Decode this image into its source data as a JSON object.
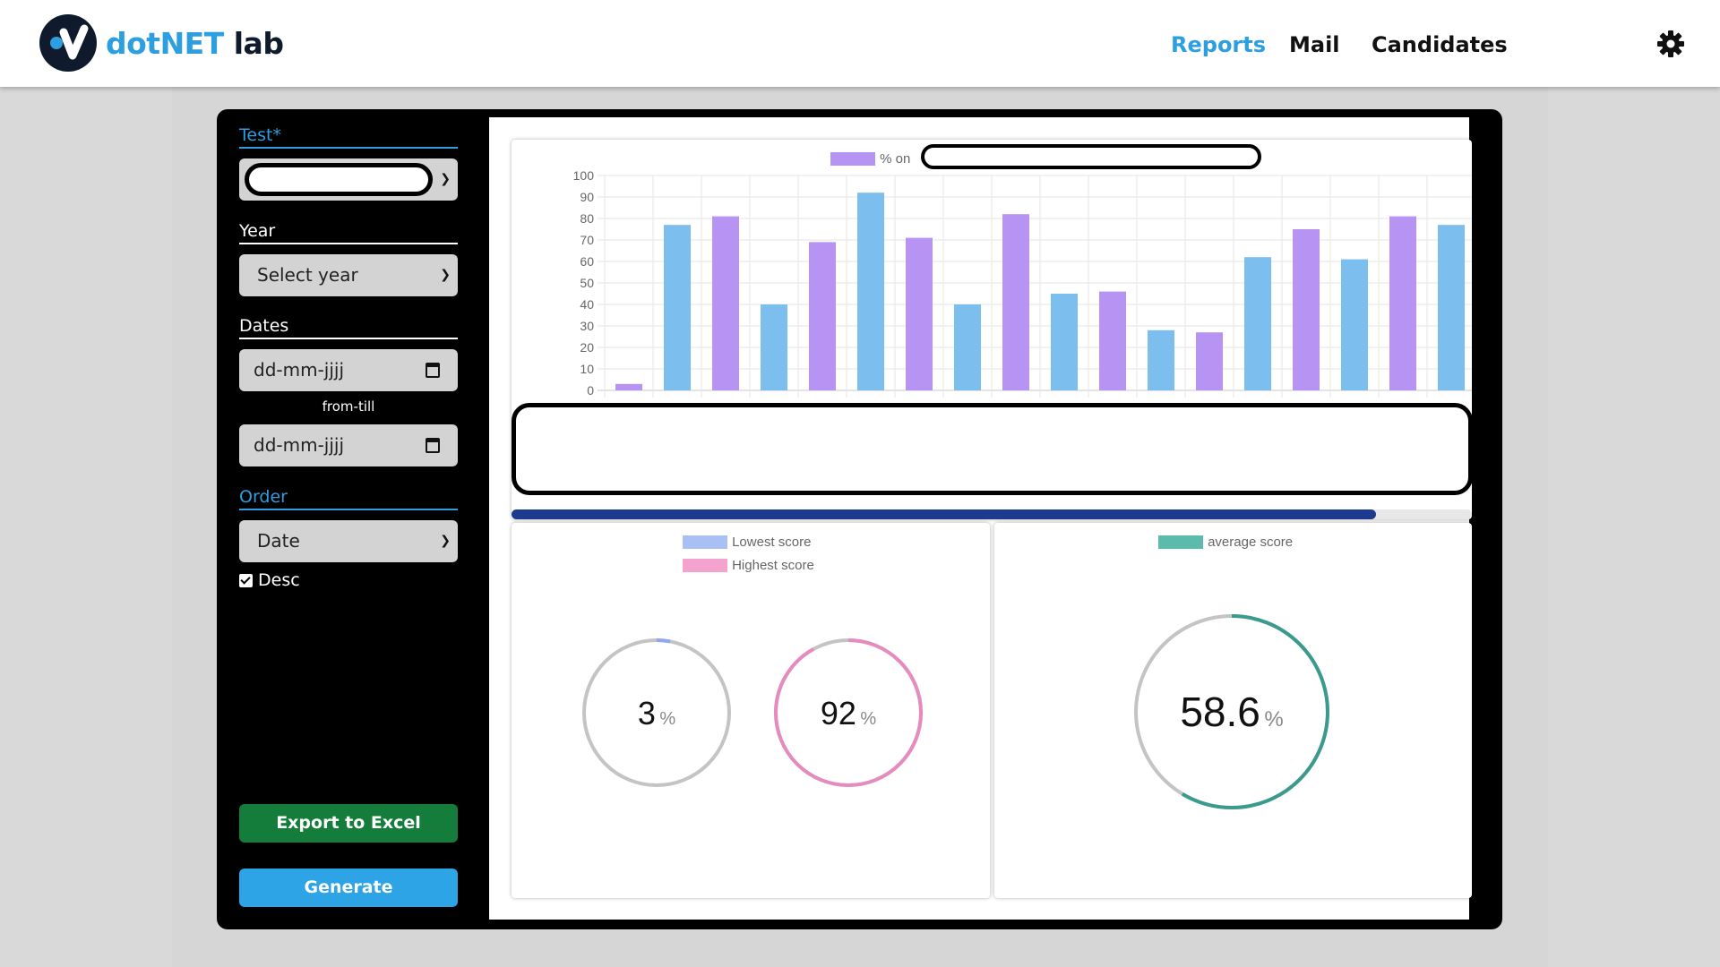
{
  "nav": {
    "logo_part1": "dotNET",
    "logo_part2": " lab",
    "links": [
      "Reports",
      "Mail",
      "Candidates"
    ],
    "active": "Reports"
  },
  "sidebar": {
    "test_label": "Test*",
    "year_label": "Year",
    "year_value": "Select year",
    "dates_label": "Dates",
    "date_placeholder": "dd-mm-jjjj",
    "from_till": "from-till",
    "order_label": "Order",
    "order_value": "Date",
    "desc_label": "Desc",
    "desc_checked": true,
    "export_label": "Export to Excel",
    "generate_label": "Generate"
  },
  "colors": {
    "accent": "#2d9ee0",
    "bar_purple": "#b794f4",
    "bar_blue": "#7cbeee",
    "lowest": "#a9c0f5",
    "highest": "#f4a3cf",
    "average": "#5bbcae",
    "scroll_thumb": "#1e3a8f",
    "export_button": "#157d3b",
    "generate_button": "#2da4e6"
  },
  "chart_data": [
    {
      "type": "bar",
      "legend_prefix": "% on",
      "ylim": [
        0,
        100
      ],
      "yticks": [
        0,
        10,
        20,
        30,
        40,
        50,
        60,
        70,
        80,
        90,
        100
      ],
      "grid": true,
      "values": [
        3,
        77,
        81,
        40,
        69,
        92,
        71,
        40,
        82,
        45,
        46,
        28,
        27,
        62,
        75,
        61,
        81,
        77
      ],
      "bar_colors": [
        "purple",
        "blue",
        "purple",
        "blue",
        "purple",
        "blue",
        "purple",
        "blue",
        "purple",
        "blue",
        "purple",
        "blue",
        "purple",
        "blue",
        "purple",
        "blue",
        "purple",
        "blue"
      ]
    },
    {
      "type": "pie",
      "legend": [
        "Lowest score",
        "Highest score"
      ],
      "gauges": [
        {
          "name": "Lowest score",
          "value": 3,
          "display": "3",
          "unit": "%"
        },
        {
          "name": "Highest score",
          "value": 92,
          "display": "92",
          "unit": "%"
        }
      ]
    },
    {
      "type": "pie",
      "legend": [
        "average score"
      ],
      "gauges": [
        {
          "name": "average score",
          "value": 58.6,
          "display": "58.6",
          "unit": "%"
        }
      ]
    }
  ]
}
